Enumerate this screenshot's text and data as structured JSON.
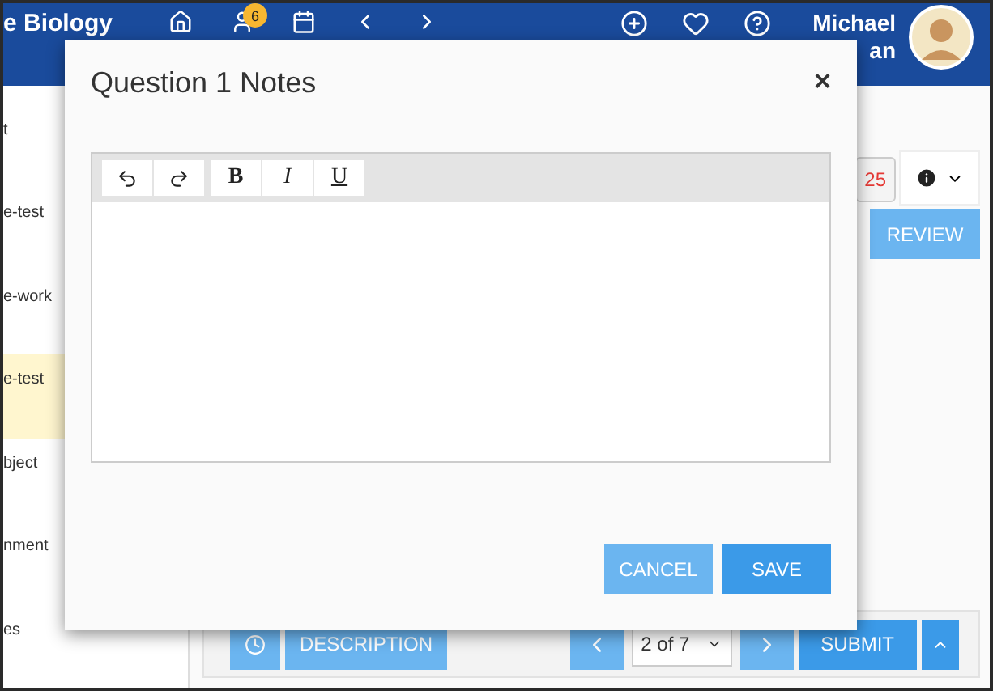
{
  "header": {
    "course": "e Biology",
    "badge": "6",
    "user_first": "Michael",
    "user_last": "an"
  },
  "sidebar": {
    "items": [
      {
        "label": "t",
        "selected": false
      },
      {
        "label": "e-test",
        "selected": false
      },
      {
        "label": "e-work",
        "selected": false
      },
      {
        "label": "e-test",
        "selected": true
      },
      {
        "label": "bject",
        "selected": false
      },
      {
        "label": "nment",
        "selected": false
      },
      {
        "label": "es",
        "selected": false
      }
    ]
  },
  "toolbar": {
    "score": "25",
    "review": "REVIEW"
  },
  "footer": {
    "description": "DESCRIPTION",
    "page": "2 of 7",
    "submit": "SUBMIT"
  },
  "dialog": {
    "title": "Question 1 Notes",
    "close": "×",
    "editor_tools": [
      {
        "kind": "undo"
      },
      {
        "kind": "redo"
      },
      {
        "kind": "bold",
        "label": "B"
      },
      {
        "kind": "italic",
        "label": "I"
      },
      {
        "kind": "underline",
        "label": "U"
      }
    ],
    "buttons": [
      {
        "label": "CANCEL",
        "kind": "secondary"
      },
      {
        "label": "SAVE",
        "kind": "primary"
      }
    ]
  }
}
